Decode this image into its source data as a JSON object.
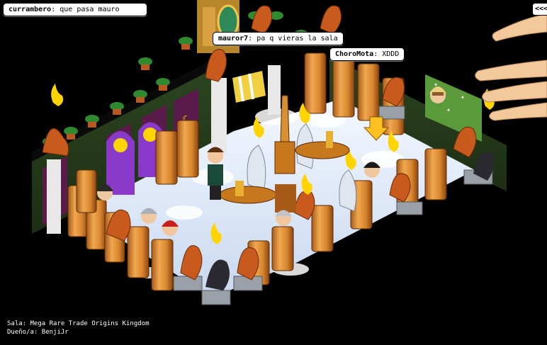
{
  "chat": [
    {
      "user": "currambero",
      "message": "que pasa mauro"
    },
    {
      "user": "mauror7",
      "message": "pa q vieras la sala"
    },
    {
      "user": "ChoroMota",
      "message": "XDDD"
    }
  ],
  "ui": {
    "collapse_label": "<<<"
  },
  "room": {
    "label_prefix": "Sala:",
    "name": "Mega Rare Trade Origins Kingdom",
    "owner_prefix": "Dueño/a:",
    "owner": "BenjiJr"
  },
  "colors": {
    "background": "#000000",
    "wall": "#3a5a2a",
    "floor_cloud": "#e8f0ff",
    "pillar": "#d8862e",
    "dragon": "#c75a1c",
    "flame": "#ffd400",
    "pedestal": "#9aa0a8",
    "hand": "#f3c89a"
  }
}
